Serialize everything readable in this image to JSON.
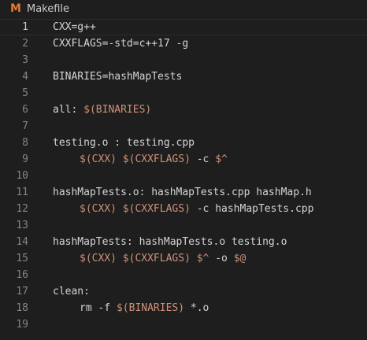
{
  "file": {
    "icon_letter": "M",
    "name": "Makefile"
  },
  "lines": [
    {
      "num": "1",
      "tokens": [
        {
          "t": "CXX=g++",
          "c": "plain"
        }
      ]
    },
    {
      "num": "2",
      "tokens": [
        {
          "t": "CXXFLAGS=-std=c++17 -g",
          "c": "plain"
        }
      ]
    },
    {
      "num": "3",
      "tokens": []
    },
    {
      "num": "4",
      "tokens": [
        {
          "t": "BINARIES=hashMapTests",
          "c": "plain"
        }
      ]
    },
    {
      "num": "5",
      "tokens": []
    },
    {
      "num": "6",
      "tokens": [
        {
          "t": "all: ",
          "c": "plain"
        },
        {
          "t": "$(BINARIES)",
          "c": "var"
        }
      ]
    },
    {
      "num": "7",
      "tokens": []
    },
    {
      "num": "8",
      "tokens": [
        {
          "t": "testing.o : testing.cpp",
          "c": "plain"
        }
      ]
    },
    {
      "num": "9",
      "indent": true,
      "tokens": [
        {
          "t": "$(CXX)",
          "c": "var"
        },
        {
          "t": " ",
          "c": "plain"
        },
        {
          "t": "$(CXXFLAGS)",
          "c": "var"
        },
        {
          "t": " -c ",
          "c": "plain"
        },
        {
          "t": "$^",
          "c": "var"
        }
      ]
    },
    {
      "num": "10",
      "tokens": []
    },
    {
      "num": "11",
      "tokens": [
        {
          "t": "hashMapTests.o: hashMapTests.cpp hashMap.h",
          "c": "plain"
        }
      ]
    },
    {
      "num": "12",
      "indent": true,
      "tokens": [
        {
          "t": "$(CXX)",
          "c": "var"
        },
        {
          "t": " ",
          "c": "plain"
        },
        {
          "t": "$(CXXFLAGS)",
          "c": "var"
        },
        {
          "t": " -c hashMapTests.cpp",
          "c": "plain"
        }
      ]
    },
    {
      "num": "13",
      "tokens": []
    },
    {
      "num": "14",
      "tokens": [
        {
          "t": "hashMapTests: hashMapTests.o testing.o",
          "c": "plain"
        }
      ]
    },
    {
      "num": "15",
      "indent": true,
      "tokens": [
        {
          "t": "$(CXX)",
          "c": "var"
        },
        {
          "t": " ",
          "c": "plain"
        },
        {
          "t": "$(CXXFLAGS)",
          "c": "var"
        },
        {
          "t": " ",
          "c": "plain"
        },
        {
          "t": "$^",
          "c": "var"
        },
        {
          "t": " -o ",
          "c": "plain"
        },
        {
          "t": "$@",
          "c": "var"
        }
      ]
    },
    {
      "num": "16",
      "tokens": []
    },
    {
      "num": "17",
      "tokens": [
        {
          "t": "clean:",
          "c": "plain"
        }
      ]
    },
    {
      "num": "18",
      "indent": true,
      "tokens": [
        {
          "t": "rm -f ",
          "c": "plain"
        },
        {
          "t": "$(BINARIES)",
          "c": "var"
        },
        {
          "t": " *.o",
          "c": "plain"
        }
      ]
    },
    {
      "num": "19",
      "tokens": []
    }
  ],
  "current_line": "1",
  "colors": {
    "background": "#1e1e1e",
    "text": "#d4d4d4",
    "variable": "#ce9178",
    "line_number": "#858585",
    "makefile_icon": "#e37933"
  }
}
